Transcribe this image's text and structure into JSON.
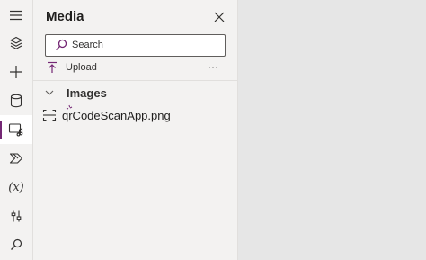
{
  "rail": {
    "items": [
      {
        "name": "hamburger-icon",
        "label": "Menu"
      },
      {
        "name": "layers-icon",
        "label": "Tree view"
      },
      {
        "name": "plus-icon",
        "label": "Insert"
      },
      {
        "name": "database-icon",
        "label": "Data"
      },
      {
        "name": "media-icon",
        "label": "Media",
        "active": true
      },
      {
        "name": "power-automate-icon",
        "label": "Power Automate"
      },
      {
        "name": "variables-icon",
        "label": "Variables",
        "text": "(x)"
      },
      {
        "name": "tools-icon",
        "label": "Advanced tools"
      },
      {
        "name": "search-icon",
        "label": "Search"
      }
    ]
  },
  "panel": {
    "title": "Media",
    "search": {
      "placeholder": "Search",
      "value": ""
    },
    "upload_label": "Upload",
    "more_label": "···",
    "group": {
      "label": "Images",
      "expanded": true
    },
    "files": [
      {
        "name": "qrCodeScanApp.png",
        "is_new": true
      }
    ]
  },
  "colors": {
    "accent": "#742774",
    "panel_bg": "#f3f2f1",
    "canvas_bg": "#e6e6e6"
  }
}
